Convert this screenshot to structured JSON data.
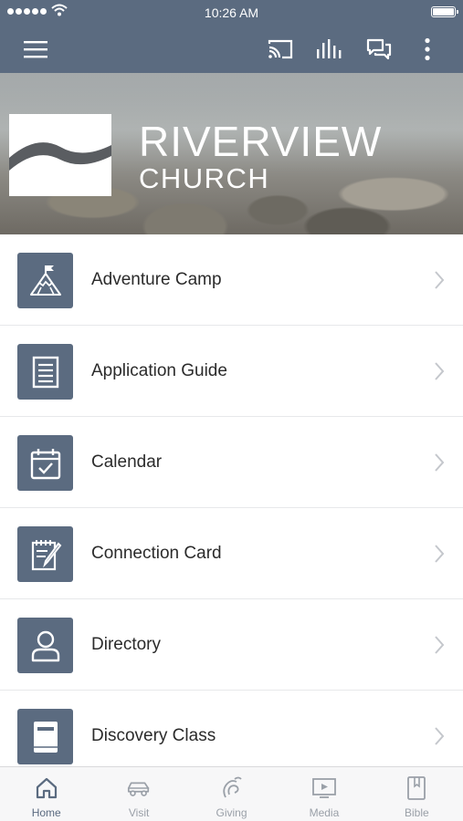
{
  "status_bar": {
    "time": "10:26 AM",
    "signal_icon": "signal-dots-icon",
    "wifi_icon": "wifi-icon",
    "battery_icon": "battery-icon"
  },
  "toolbar": {
    "menu_icon": "hamburger-menu-icon",
    "actions": [
      "cast-icon",
      "audio-bars-icon",
      "chat-icon",
      "more-vertical-icon"
    ]
  },
  "hero": {
    "brand_line1": "RIVERVIEW",
    "brand_line2": "CHURCH",
    "logo_icon": "river-wave-logo"
  },
  "menu": {
    "items": [
      {
        "label": "Adventure Camp",
        "icon": "mountain-flag-icon"
      },
      {
        "label": "Application Guide",
        "icon": "document-icon"
      },
      {
        "label": "Calendar",
        "icon": "calendar-check-icon"
      },
      {
        "label": "Connection Card",
        "icon": "notepad-pen-icon"
      },
      {
        "label": "Directory",
        "icon": "person-icon"
      },
      {
        "label": "Discovery Class",
        "icon": "book-icon"
      }
    ]
  },
  "tabbar": {
    "tabs": [
      {
        "label": "Home",
        "icon": "home-icon",
        "active": true
      },
      {
        "label": "Visit",
        "icon": "car-icon",
        "active": false
      },
      {
        "label": "Giving",
        "icon": "giving-hand-icon",
        "active": false
      },
      {
        "label": "Media",
        "icon": "media-play-icon",
        "active": false
      },
      {
        "label": "Bible",
        "icon": "bible-bookmark-icon",
        "active": false
      }
    ]
  },
  "colors": {
    "primary": "#5b6b80",
    "tab_inactive": "#9aa0a8",
    "text": "#2b2b2b",
    "divider": "#e7e8ea"
  }
}
